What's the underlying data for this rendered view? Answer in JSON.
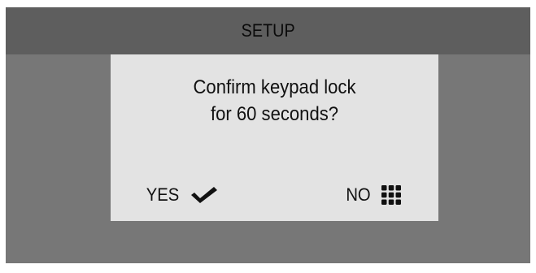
{
  "header": {
    "title": "SETUP"
  },
  "dialog": {
    "message_line1": "Confirm keypad lock",
    "message_line2": "for 60 seconds?",
    "yes_label": "YES",
    "no_label": "NO",
    "yes_icon": "checkmark-icon",
    "no_icon": "keypad-icon"
  },
  "colors": {
    "background": "#777777",
    "header_bar": "#5e5e5e",
    "dialog": "#e3e3e3",
    "text": "#111111"
  }
}
